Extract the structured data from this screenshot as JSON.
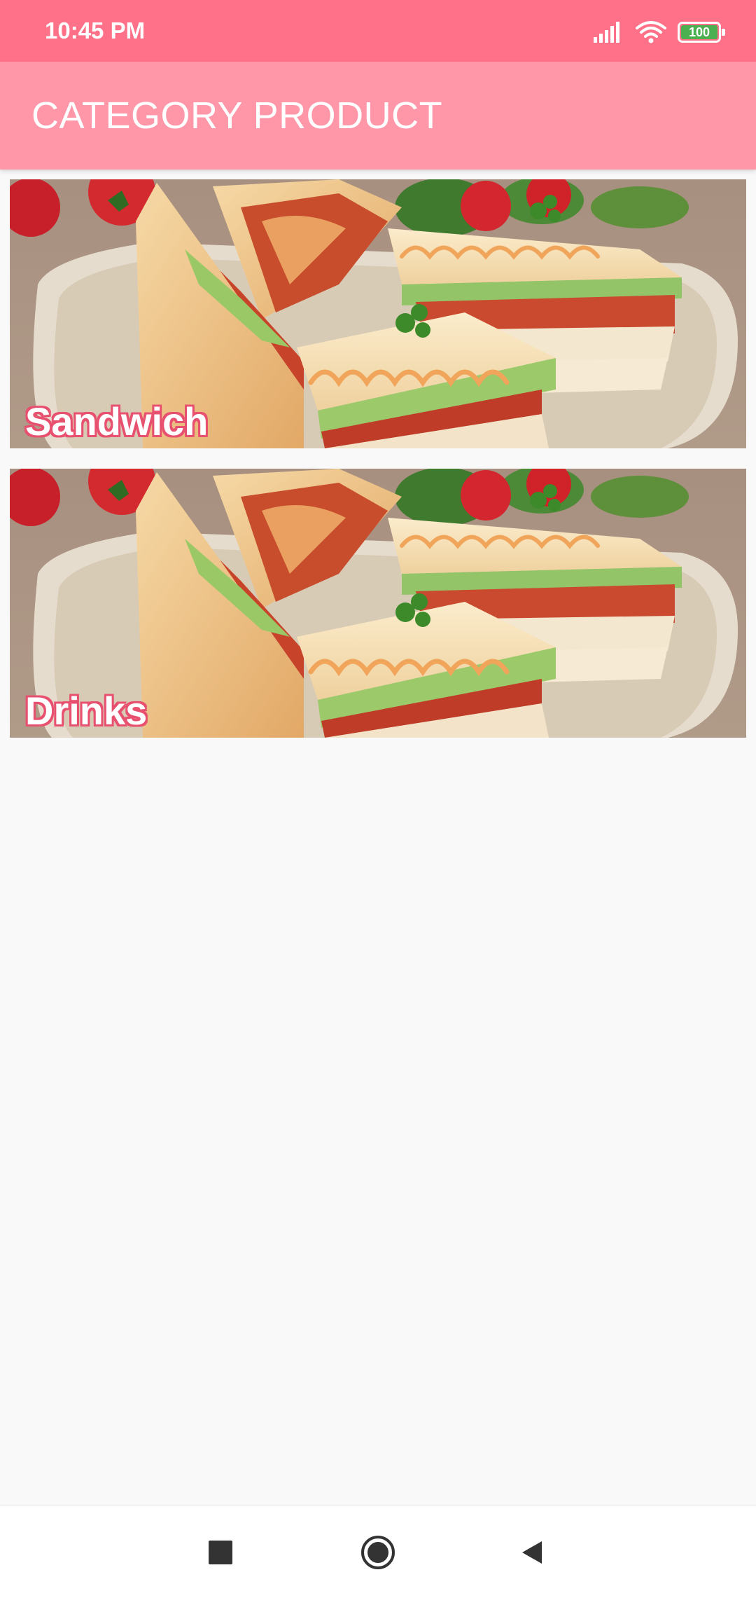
{
  "status_bar": {
    "time": "10:45 PM",
    "battery_level": "100",
    "icons": [
      "signal-icon",
      "wifi-icon",
      "battery-icon"
    ]
  },
  "app_bar": {
    "title": "CATEGORY PRODUCT"
  },
  "categories": [
    {
      "label": "Sandwich",
      "image": "sandwich-photo"
    },
    {
      "label": "Drinks",
      "image": "sandwich-photo"
    }
  ],
  "nav_bar": {
    "buttons": [
      "recents-icon",
      "home-icon",
      "back-icon"
    ]
  },
  "colors": {
    "status_bar": "#ff7089",
    "app_bar": "#ff97a9",
    "background": "#f9f9f9",
    "label_outline": "#e8506f",
    "battery": "#4caf50"
  }
}
